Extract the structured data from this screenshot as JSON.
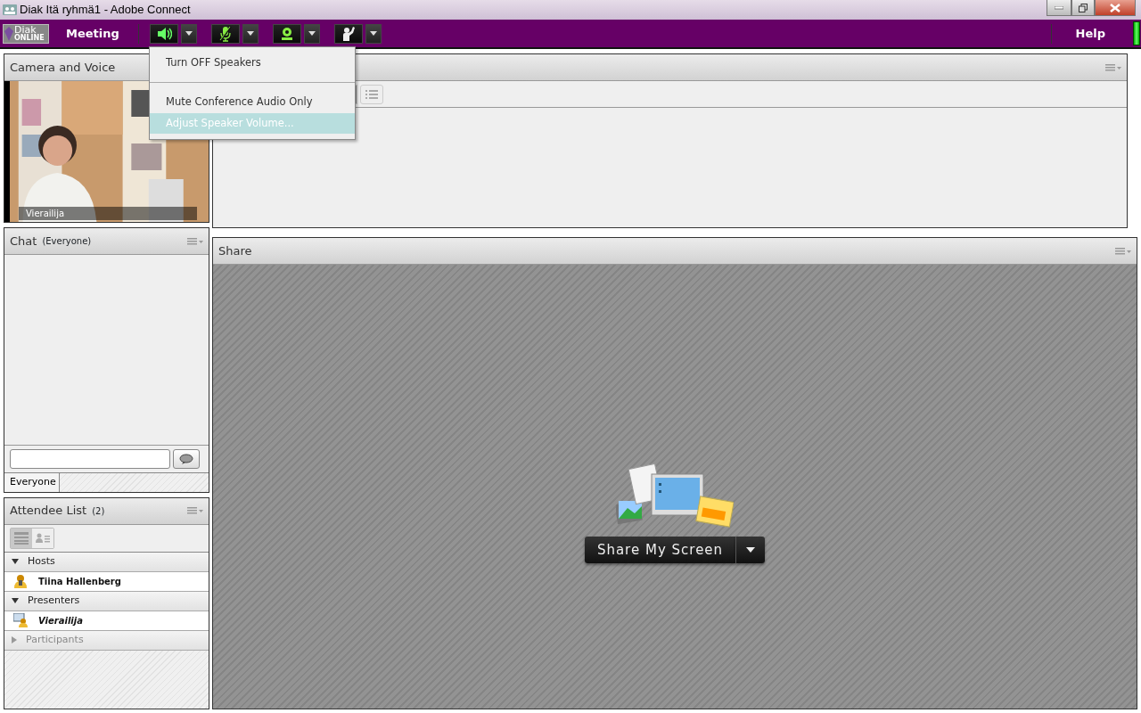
{
  "window": {
    "title": "Diak Itä ryhmä1 - Adobe Connect"
  },
  "toolbar": {
    "logo": {
      "name": "Diak",
      "tagline": "ONLINE"
    },
    "meeting_menu": "Meeting",
    "help": "Help",
    "buttons": [
      {
        "kind": "speaker",
        "on": true
      },
      {
        "kind": "microphone",
        "on": false
      },
      {
        "kind": "camera",
        "on": true
      },
      {
        "kind": "raise-hand",
        "on": false
      }
    ]
  },
  "speaker_menu": {
    "items": [
      {
        "kind": "item",
        "label": "Turn OFF Speakers",
        "selected": false
      },
      {
        "kind": "separator"
      },
      {
        "kind": "item",
        "label": "Mute Conference Audio Only",
        "selected": false
      },
      {
        "kind": "item",
        "label": "Adjust Speaker Volume...",
        "selected": true
      }
    ]
  },
  "camera_pod": {
    "title": "Camera and Voice",
    "video_label": "Vierailija"
  },
  "chat_pod": {
    "title": "Chat",
    "audience": "(Everyone)",
    "tab": "Everyone"
  },
  "attendee_pod": {
    "title": "Attendee List",
    "count": "(2)",
    "views": [
      {
        "kind": "list",
        "selected": true
      },
      {
        "kind": "cards",
        "selected": false
      }
    ],
    "groups": [
      {
        "label": "Hosts",
        "expanded": true,
        "attendees": [
          {
            "name": "Tiina Hallenberg",
            "kind": "host",
            "is_self": false
          }
        ]
      },
      {
        "label": "Presenters",
        "expanded": true,
        "attendees": [
          {
            "name": "Vierailija",
            "kind": "presenter",
            "is_self": true
          }
        ]
      },
      {
        "label": "Participants",
        "expanded": false
      }
    ]
  },
  "share_pod": {
    "title": "Share",
    "button": "Share My Screen"
  }
}
